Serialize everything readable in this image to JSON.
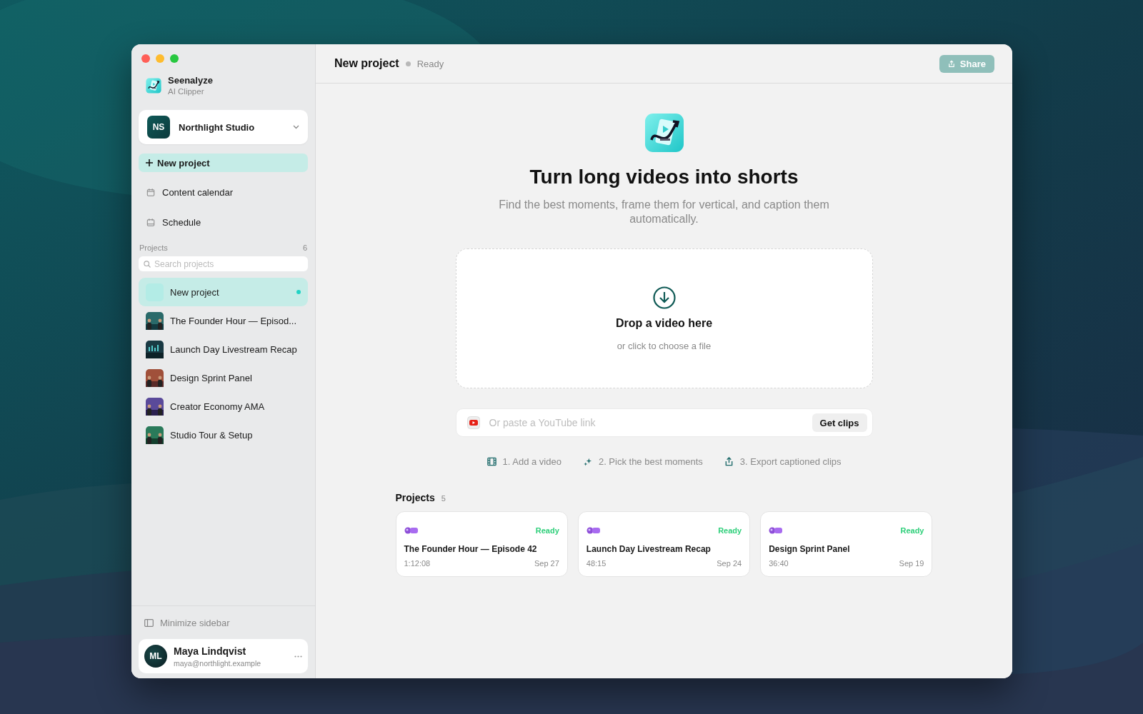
{
  "app": {
    "name": "Seenalyze",
    "subtitle": "AI Clipper"
  },
  "workspace": {
    "initials": "NS",
    "name": "Northlight Studio"
  },
  "new_project_button": "New project",
  "nav": [
    {
      "kind": "calendar",
      "label": "Content calendar"
    },
    {
      "kind": "schedule",
      "label": "Schedule"
    }
  ],
  "projects_section": {
    "label": "Projects",
    "count": "6",
    "search": {
      "placeholder": "Search projects"
    },
    "items": [
      {
        "title": "New project",
        "kind": "blank",
        "selected": true
      },
      {
        "title": "The Founder Hour — Episod...",
        "kind": "picture",
        "selected": false
      },
      {
        "title": "Launch Day Livestream Recap",
        "kind": "picture",
        "selected": false
      },
      {
        "title": "Design Sprint Panel",
        "kind": "picture",
        "selected": false
      },
      {
        "title": "Creator Economy AMA",
        "kind": "picture",
        "selected": false
      },
      {
        "title": "Studio Tour & Setup",
        "kind": "picture",
        "selected": false
      }
    ]
  },
  "minimize_sidebar": "Minimize sidebar",
  "user": {
    "initials": "ML",
    "name": "Maya Lindqvist",
    "email": "maya@northlight.example"
  },
  "header": {
    "title": "New project",
    "status": "Ready",
    "share": {
      "label": "Share",
      "disabled": true
    }
  },
  "hero": {
    "title": "Turn long videos into shorts",
    "subtitle": "Find the best moments, frame them for vertical, and caption them automatically."
  },
  "dropzone": {
    "title": "Drop a video here",
    "hint": "or click to choose a file"
  },
  "link_field": {
    "placeholder": "Or paste a YouTube link",
    "button": "Get clips"
  },
  "steps": [
    {
      "kind": "add",
      "label": "1. Add a video"
    },
    {
      "kind": "pick",
      "label": "2. Pick the best moments"
    },
    {
      "kind": "export",
      "label": "3. Export captioned clips"
    }
  ],
  "recent": {
    "title": "Projects",
    "count": "5",
    "cards": [
      {
        "title": "The Founder Hour — Episode 42",
        "status": "Ready",
        "duration": "1:12:08",
        "date": "Sep 27"
      },
      {
        "title": "Launch Day Livestream Recap",
        "status": "Ready",
        "duration": "48:15",
        "date": "Sep 24"
      },
      {
        "title": "Design Sprint Panel",
        "status": "Ready",
        "duration": "36:40",
        "date": "Sep 19"
      }
    ]
  }
}
